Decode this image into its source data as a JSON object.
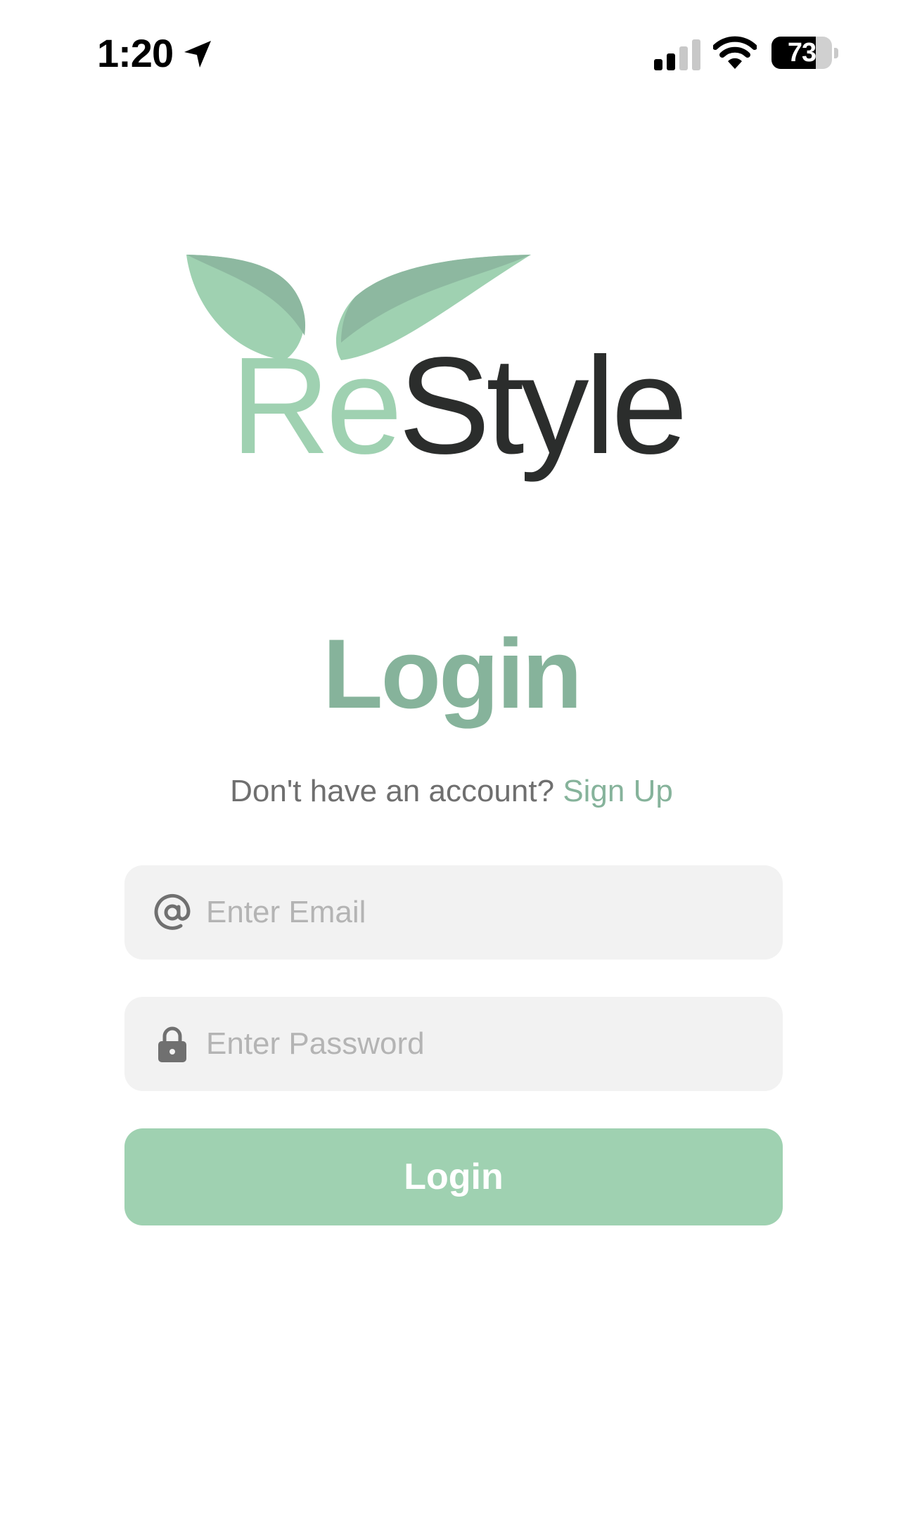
{
  "status_bar": {
    "time": "1:20",
    "battery_level": "73",
    "battery_fraction": 0.73,
    "signal_bars_active": 2,
    "signal_bars_total": 4
  },
  "logo": {
    "part1": "Re",
    "part2": "Style",
    "color_light": "#9fd1b1",
    "color_dark": "#2b2d2c",
    "leaf_light": "#9fd1b1",
    "leaf_dark": "#8db8a0"
  },
  "login": {
    "title": "Login",
    "signup_prompt": "Don't have an account?",
    "signup_link": "Sign Up",
    "email_placeholder": "Enter Email",
    "password_placeholder": "Enter Password",
    "button_label": "Login"
  },
  "colors": {
    "accent": "#86b39b",
    "button": "#9fd1b1",
    "field_background": "#f2f2f2",
    "placeholder": "#b4b4b4"
  },
  "icons": {
    "email": "at-sign-icon",
    "password": "lock-icon",
    "location": "location-arrow-icon",
    "wifi": "wifi-icon",
    "signal": "cellular-signal-icon",
    "battery": "battery-icon"
  }
}
